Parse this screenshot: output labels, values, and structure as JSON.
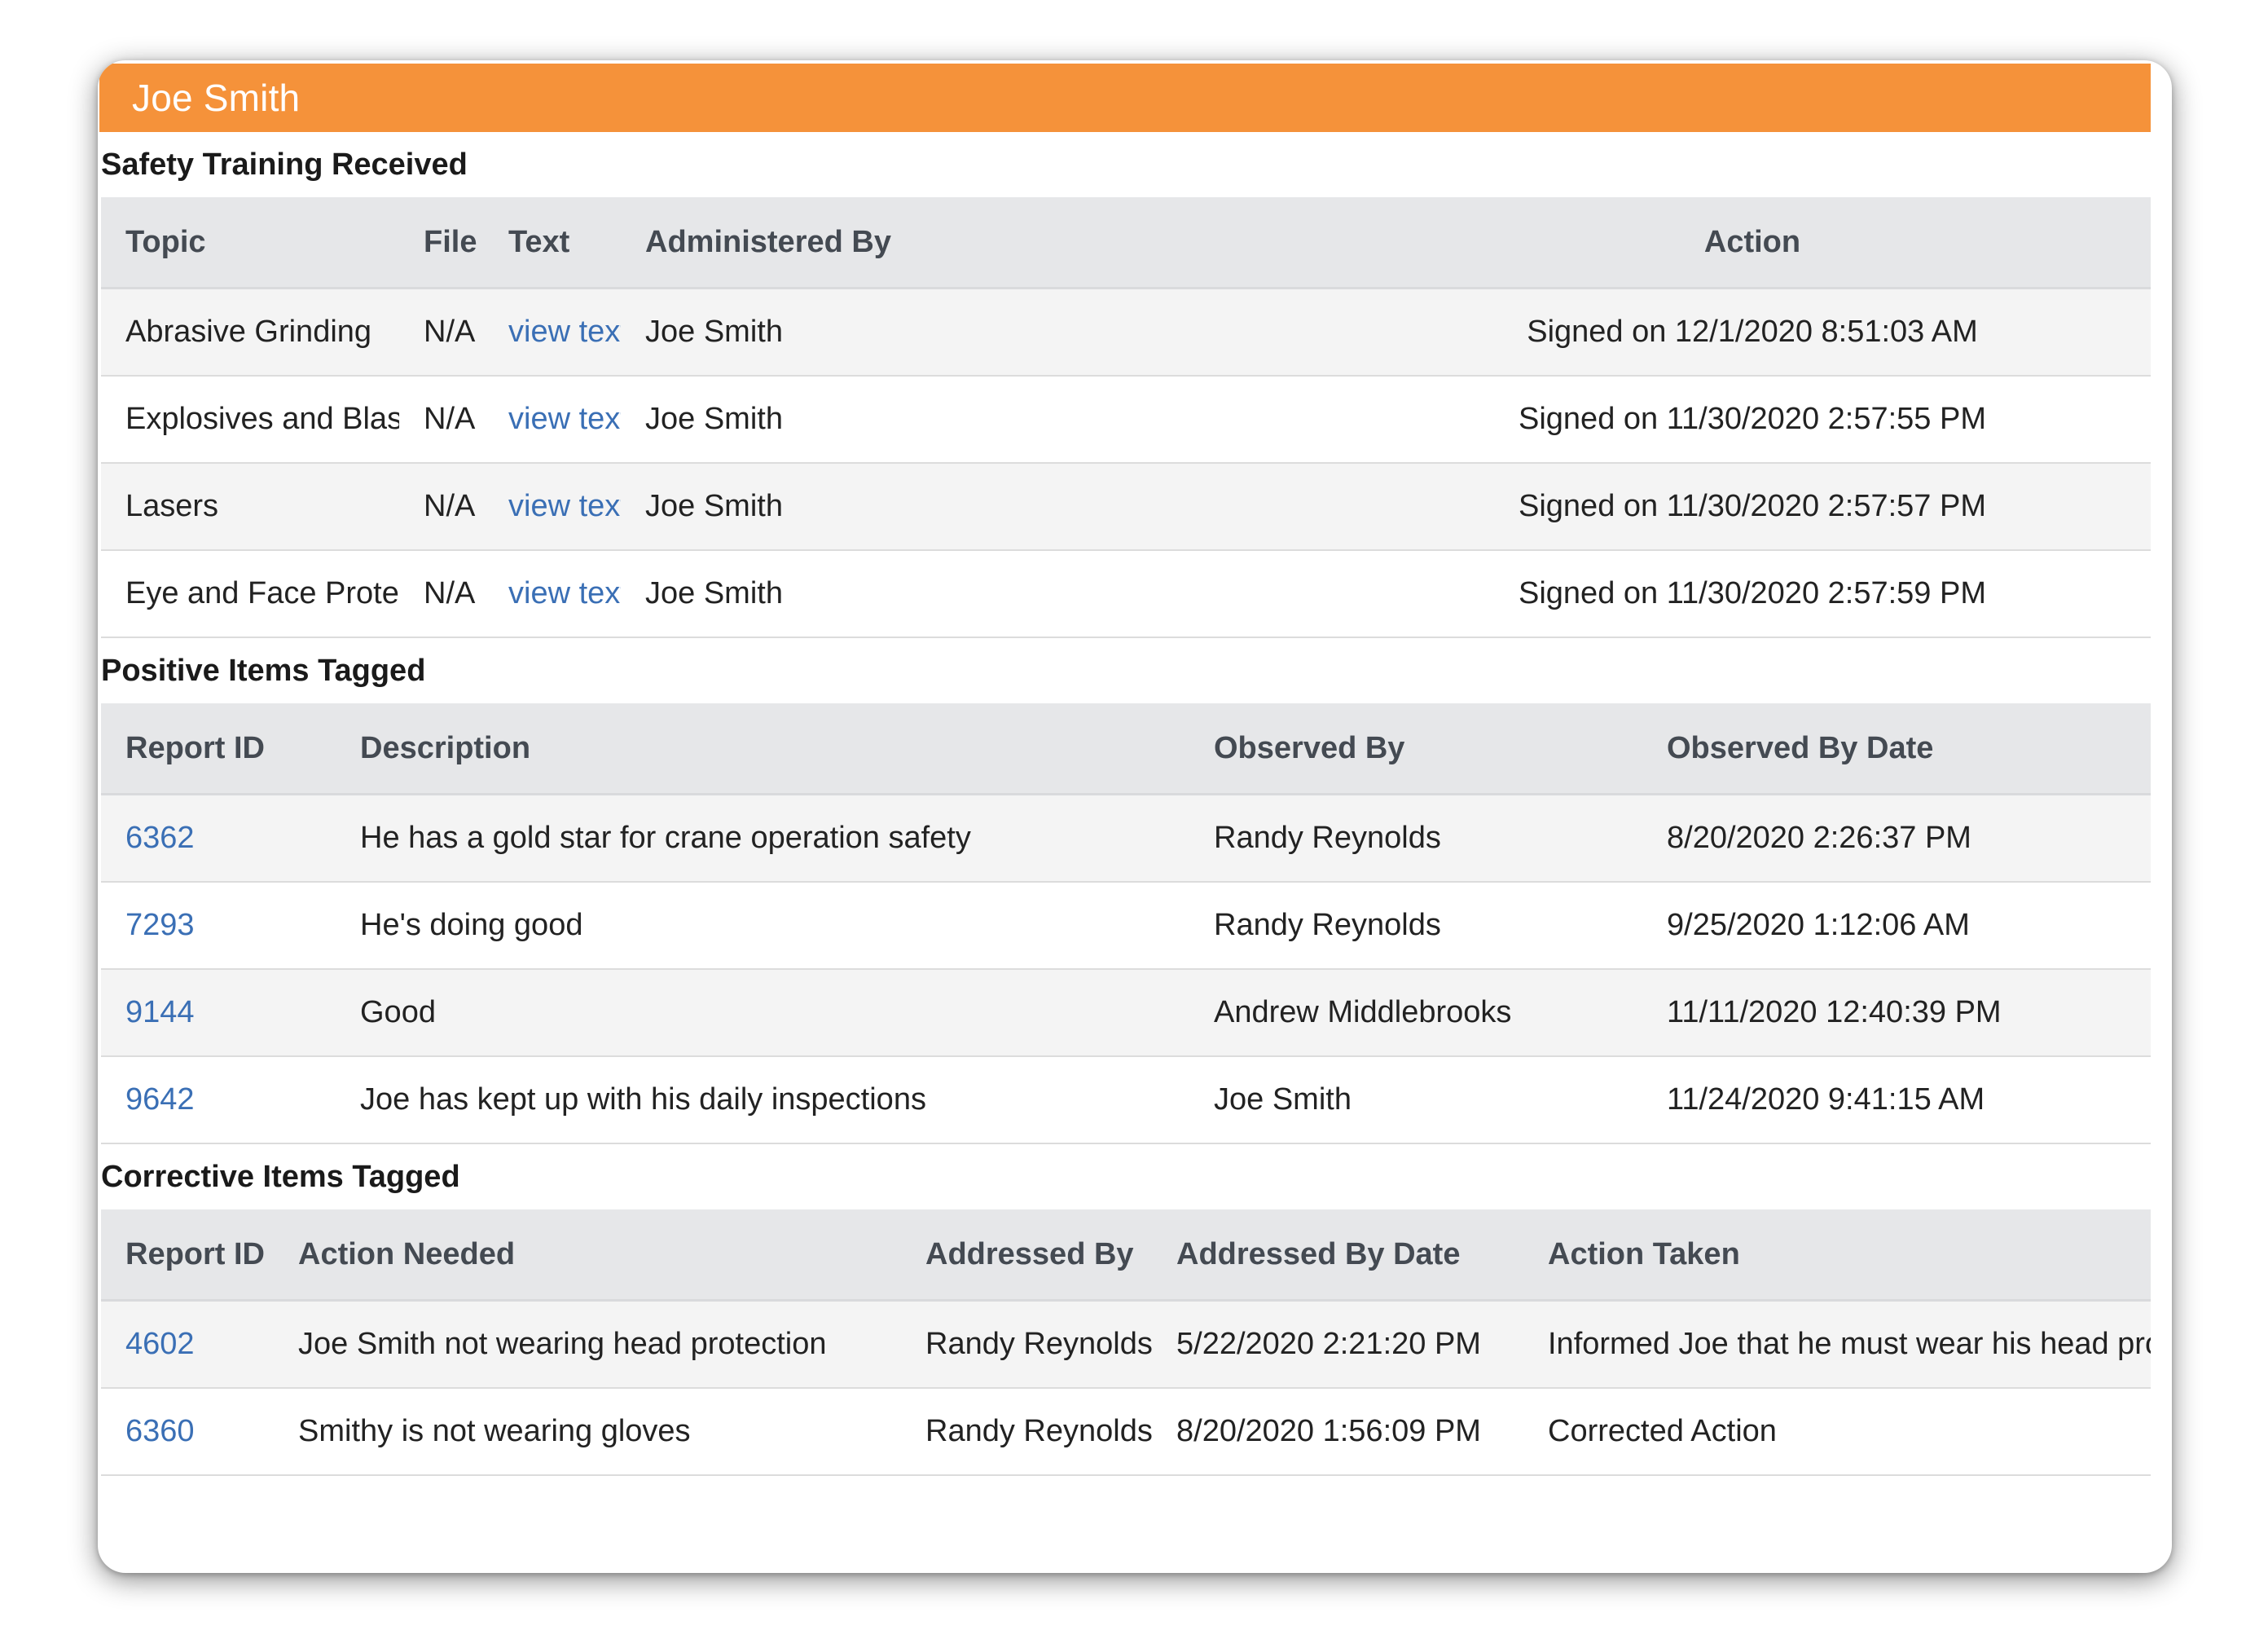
{
  "panel": {
    "title": "Joe Smith"
  },
  "training": {
    "section_title": "Safety Training Received",
    "headers": {
      "topic": "Topic",
      "file": "File",
      "text": "Text",
      "administered_by": "Administered By",
      "action": "Action"
    },
    "rows": [
      {
        "topic": "Abrasive Grinding",
        "file": "N/A",
        "text": "view text",
        "administered_by": "Joe Smith",
        "action": "Signed on 12/1/2020 8:51:03 AM"
      },
      {
        "topic": "Explosives and Blasting",
        "file": "N/A",
        "text": "view text",
        "administered_by": "Joe Smith",
        "action": "Signed on 11/30/2020 2:57:55 PM"
      },
      {
        "topic": "Lasers",
        "file": "N/A",
        "text": "view text",
        "administered_by": "Joe Smith",
        "action": "Signed on 11/30/2020 2:57:57 PM"
      },
      {
        "topic": "Eye and Face Protection",
        "file": "N/A",
        "text": "view text",
        "administered_by": "Joe Smith",
        "action": "Signed on 11/30/2020 2:57:59 PM"
      }
    ]
  },
  "positive": {
    "section_title": "Positive Items Tagged",
    "headers": {
      "report_id": "Report ID",
      "description": "Description",
      "observed_by": "Observed By",
      "observed_by_date": "Observed By Date"
    },
    "rows": [
      {
        "report_id": "6362",
        "description": "He has a gold star for crane operation safety",
        "observed_by": "Randy Reynolds",
        "observed_by_date": "8/20/2020 2:26:37 PM"
      },
      {
        "report_id": "7293",
        "description": "He's doing good",
        "observed_by": "Randy Reynolds",
        "observed_by_date": "9/25/2020 1:12:06 AM"
      },
      {
        "report_id": "9144",
        "description": "Good",
        "observed_by": "Andrew Middlebrooks",
        "observed_by_date": "11/11/2020 12:40:39 PM"
      },
      {
        "report_id": "9642",
        "description": "Joe has kept up with his daily inspections",
        "observed_by": "Joe Smith",
        "observed_by_date": "11/24/2020 9:41:15 AM"
      }
    ]
  },
  "corrective": {
    "section_title": "Corrective Items Tagged",
    "headers": {
      "report_id": "Report ID",
      "action_needed": "Action Needed",
      "addressed_by": "Addressed By",
      "addressed_by_date": "Addressed By Date",
      "action_taken": "Action Taken"
    },
    "rows": [
      {
        "report_id": "4602",
        "action_needed": "Joe Smith not wearing head protection",
        "addressed_by": "Randy Reynolds",
        "addressed_by_date": "5/22/2020 2:21:20 PM",
        "action_taken": "Informed Joe that he must wear his head protec"
      },
      {
        "report_id": "6360",
        "action_needed": "Smithy is not wearing gloves",
        "addressed_by": "Randy Reynolds",
        "addressed_by_date": "8/20/2020 1:56:09 PM",
        "action_taken": "Corrected Action"
      }
    ]
  },
  "colors": {
    "header_bar": "#f5923a",
    "link": "#3a6fb5",
    "table_header_bg": "#e6e7e9"
  }
}
